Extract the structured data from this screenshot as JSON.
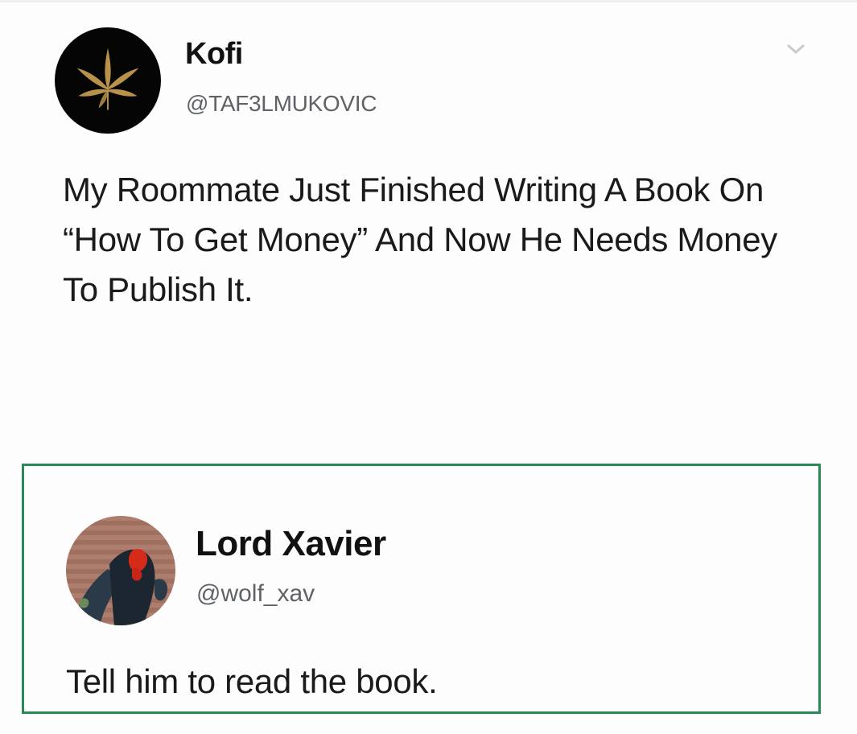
{
  "tweet": {
    "author_name": "Kofi",
    "author_handle": "@TAF3LMUKOVIC",
    "text": "My Roommate Just Finished Writing A Book On “How To Get Money” And Now He Needs Money To Publish It.",
    "avatar_icon": "cannabis-leaf-icon",
    "menu_icon": "chevron-down-icon"
  },
  "reply": {
    "author_name": "Lord Xavier",
    "author_handle": "@wolf_xav",
    "text": "Tell him to read the book.",
    "border_color": "#2a8a57"
  }
}
